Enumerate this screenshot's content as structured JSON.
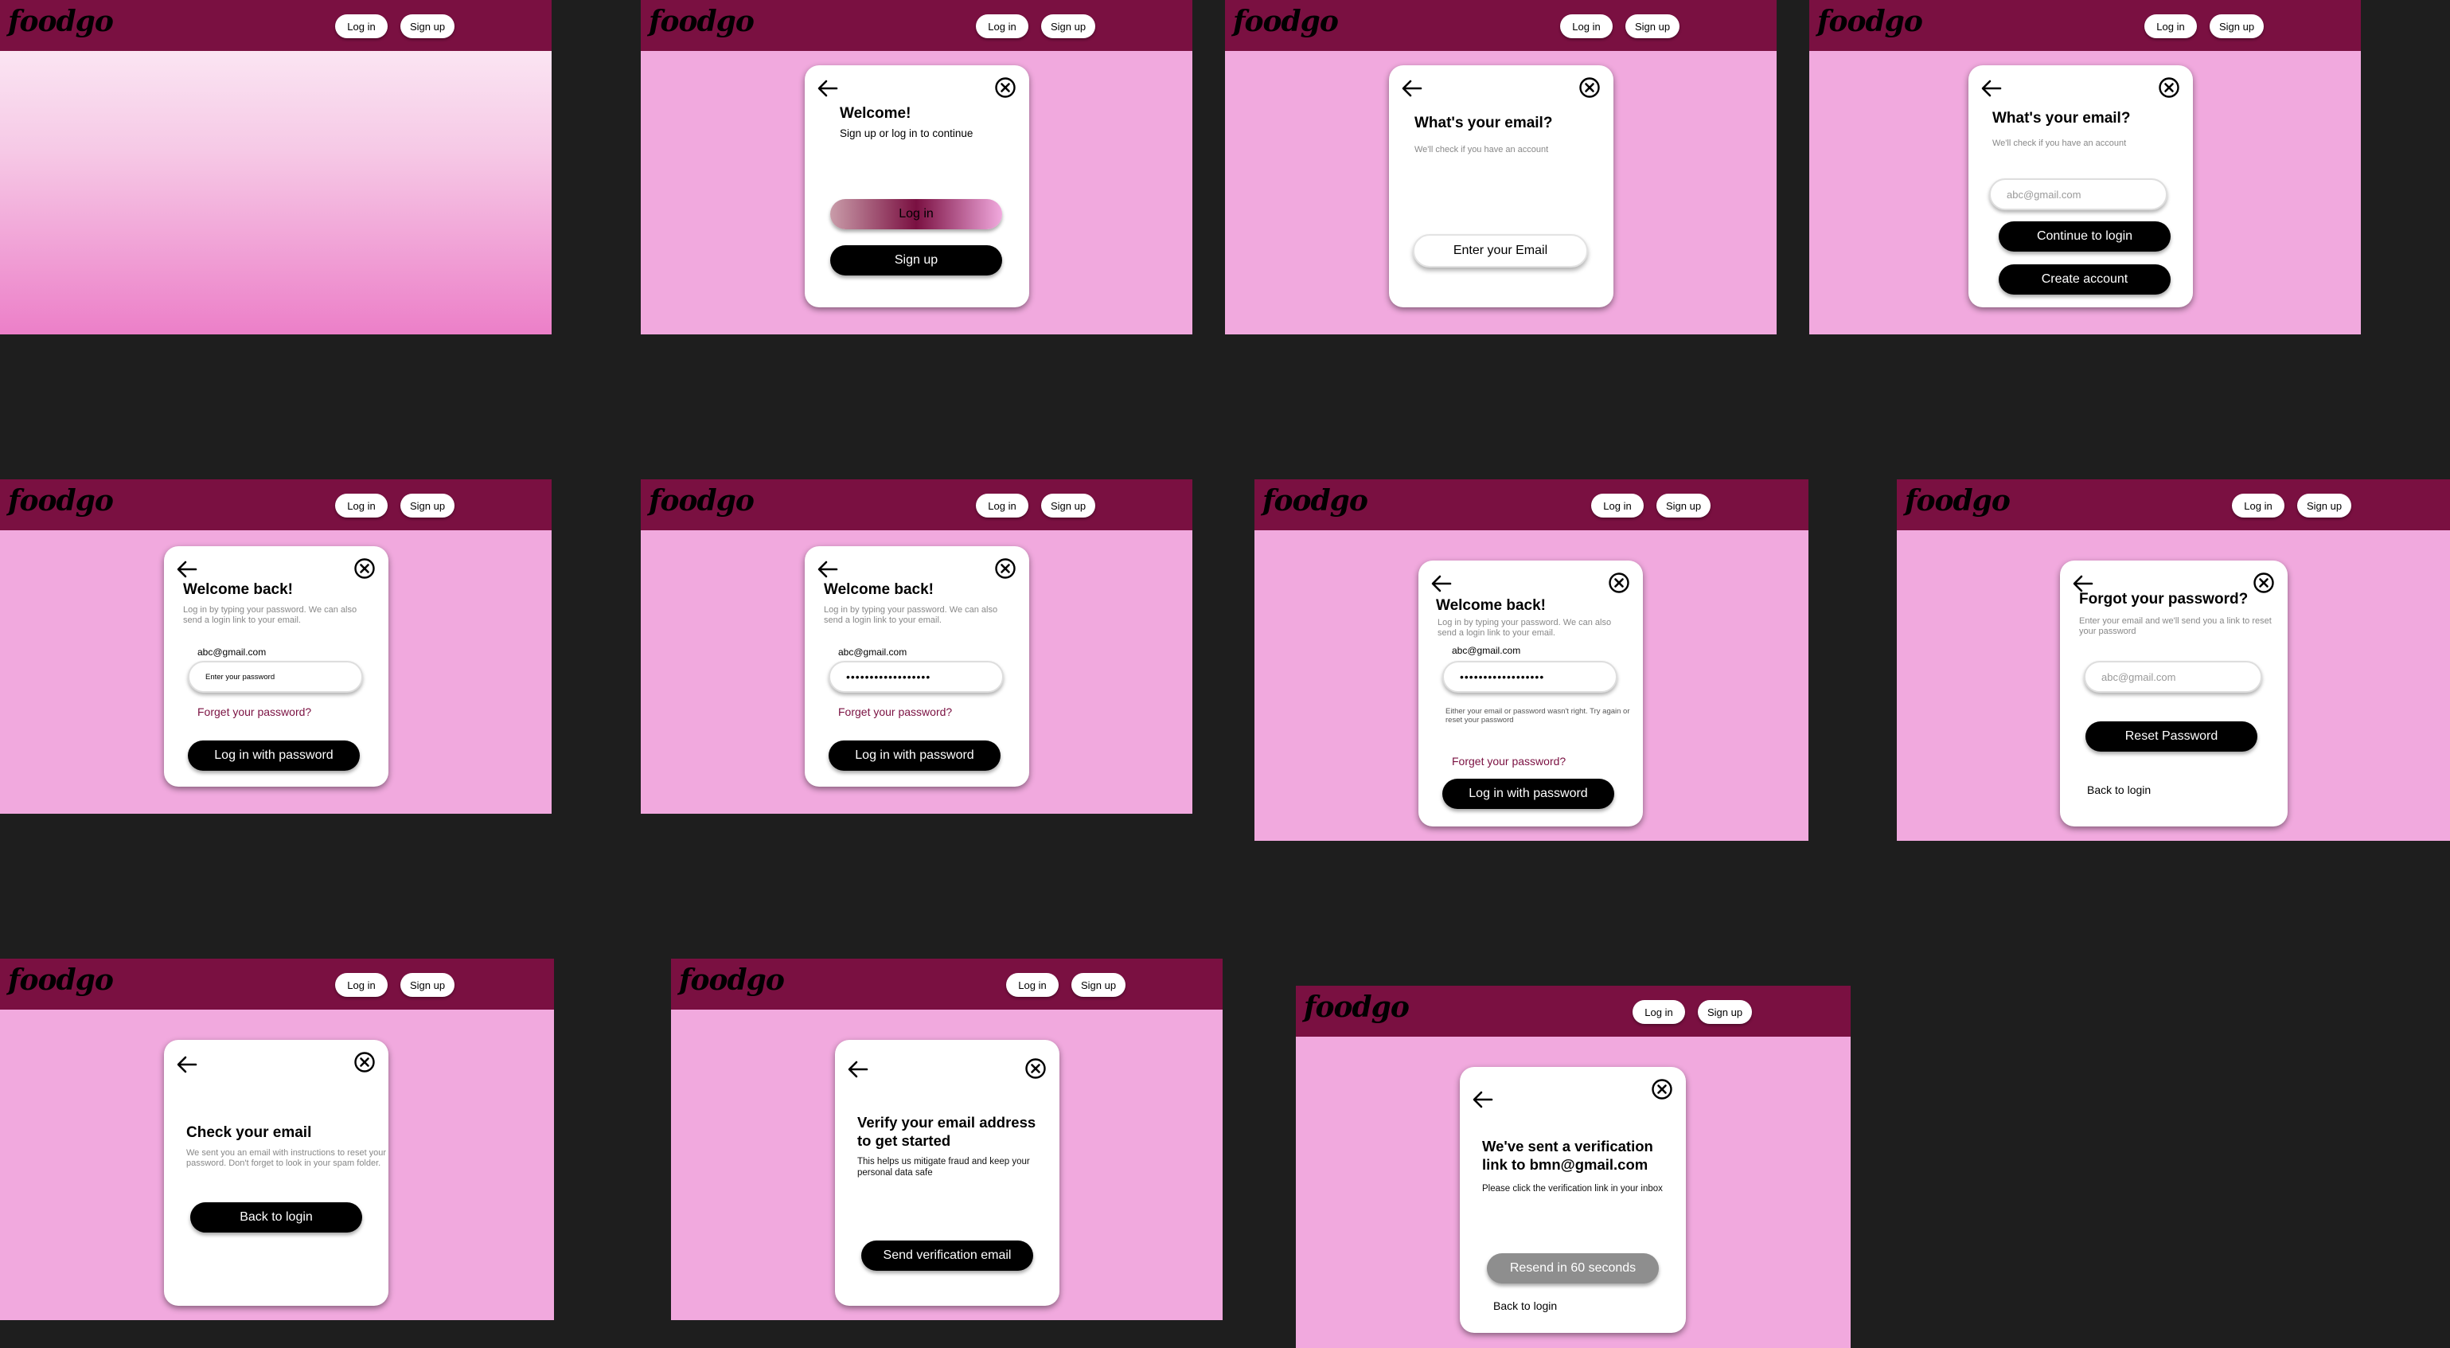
{
  "header": {
    "logo": "foodgo",
    "login_label": "Log in",
    "signup_label": "Sign up"
  },
  "icons": {
    "back": "arrow-left-icon",
    "close": "close-circle-icon"
  },
  "colors": {
    "header": "#7a1041",
    "frame_bg": "#f1a9de",
    "canvas_bg": "#1e1e1e",
    "link": "#7a1041"
  },
  "screens": {
    "welcome": {
      "title": "Welcome!",
      "subtitle": "Sign up or log in to continue",
      "login_button": "Log in",
      "signup_button": "Sign up"
    },
    "email_empty": {
      "title": "What's your email?",
      "subtitle": "We'll check if you have an account",
      "email_button": "Enter your Email"
    },
    "email_filled": {
      "title": "What's your email?",
      "subtitle": "We'll check if you have an account",
      "email_placeholder": "abc@gmail.com",
      "continue_button": "Continue to login",
      "create_button": "Create account"
    },
    "password": {
      "title": "Welcome back!",
      "subtitle": "Log in by typing your password. We can also send a login link to your email.",
      "email": "abc@gmail.com",
      "password_placeholder": "Enter your password",
      "password_masked": "••••••••••••••••••",
      "forgot_link": "Forget your password?",
      "submit_button": "Log in with password",
      "error": "Either your email or password wasn't right. Try again or reset your password"
    },
    "forgot": {
      "title": "Forgot your password?",
      "subtitle": "Enter your email and we'll send you a link to reset your password",
      "email_placeholder": "abc@gmail.com",
      "reset_button": "Reset Password",
      "back_link": "Back to login"
    },
    "check_email": {
      "title": "Check your email",
      "subtitle": "We sent you an email with instructions to reset your password. Don't forget to look in your spam folder.",
      "back_button": "Back to login"
    },
    "verify": {
      "title": "Verify your email address to get started",
      "subtitle": "This helps us mitigate fraud and keep your personal data safe",
      "send_button": "Send verification email"
    },
    "sent": {
      "title": "We've sent a verification link to bmn@gmail.com",
      "subtitle": "Please click the verification link in your inbox",
      "resend_button": "Resend in 60 seconds",
      "back_link": "Back to login"
    }
  }
}
